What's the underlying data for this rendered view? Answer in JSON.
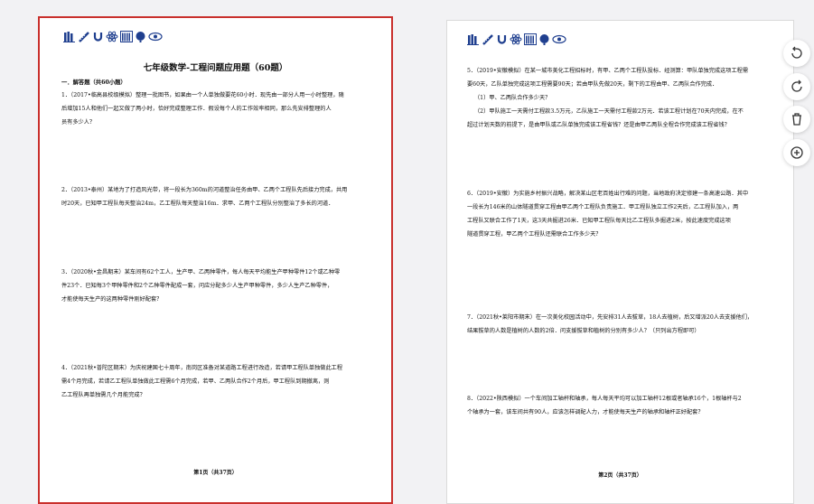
{
  "page1": {
    "doc_title": "七年级数学-工程问题应用题（60题）",
    "section": "一．解答题（共60小题）",
    "questions": [
      {
        "lines": [
          "1．（2017•临高县校级模拟）整理一批图书，如果由一个人单独做要花60小时．现先由一部分人用一小时整理，随",
          "后增加15人和他们一起又做了两小时，恰好完成整理工作．假设每个人的工作效率相同，那么先安排整理的人",
          "员有多少人？"
        ]
      },
      {
        "lines": [
          "2．（2013•泰州）某地为了打造风光带，将一段长为360m的河道整治任务由甲、乙两个工程队先后接力完成，共用",
          "时20天，已知甲工程队每天整治24m，乙工程队每天整治16m．求甲、乙两个工程队分别整治了多长的河道．"
        ]
      },
      {
        "lines": [
          "3．（2020秋•金昌期末）某车间有62个工人，生产甲、乙两种零件，每人每天平均能生产甲种零件12个或乙种零",
          "件23个．已知每3个甲种零件和2个乙种零件配成一套，问应分配多少人生产甲种零件，多少人生产乙种零件，",
          "才能使每天生产的这两种零件刚好配套？"
        ]
      },
      {
        "lines": [
          "4．（2021秋•普陀区期末）为庆祝建国七十周年，南岗区准备对某道路工程进行改造，若请甲工程队单独做此工程",
          "需4个月完成，若请乙工程队单独做此工程需6个月完成，若甲、乙两队合作2个月后，甲工程队到期撤离，则",
          "乙工程队再单独需几个月能完成？"
        ]
      }
    ],
    "footer": "第1页（共37页）"
  },
  "page2": {
    "questions": [
      {
        "lines": [
          "5．（2019•安徽模拟）在某一城市美化工程招标时，有甲、乙两个工程队投标．经测算：甲队单独完成这项工程需",
          "要60天，乙队单独完成这项工程需要90天；若由甲队先做20天，剩下的工程由甲、乙两队合作完成．",
          "（1）甲、乙两队合作多少天？",
          "（2）甲队施工一天需付工程款3.5万元，乙队施工一天需付工程款2万元．若该工程计划在70天内完成，在不",
          "超过计划天数的前提下，是由甲队或乙队单独完成该工程省钱？还是由甲乙两队全程合作完成该工程省钱？"
        ]
      },
      {
        "lines": [
          "6．（2019•安徽）为实施乡村振兴战略，解决某山区老百姓出行难的问题，当地政府决定修建一条高速公路．其中",
          "一段长为146米的山体隧道贯穿工程由甲乙两个工程队负责施工．甲工程队独立工作2天后，乙工程队加入，两",
          "工程队又联合工作了1天，这3天共掘进26米．已知甲工程队每天比乙工程队多掘进2米，按此速度完成这项",
          "隧道贯穿工程，甲乙两个工程队还需联合工作多少天？"
        ]
      },
      {
        "lines": [
          "7．（2021秋•莱阳市期末）在一次美化校园活动中，先安排31人去拔草，18人去植树，后又增派20人去支援他们，",
          "结果拔草的人数是植树的人数的2倍．问支援拔草和植树的分别有多少人？（只列出方程即可）"
        ]
      },
      {
        "lines": [
          "8．（2022•陕西模拟）一个车间加工轴杆和轴承，每人每天平均可以加工轴杆12根或者轴承16个，1根轴杆与2",
          "个轴承为一套，该车间共有90人，应该怎样调配人力，才能使每天生产的轴承和轴杆正好配套？"
        ]
      }
    ],
    "footer": "第2页（共37页）"
  },
  "header_icons": [
    "books-icon",
    "ruler-icon",
    "magnet-icon",
    "atom-icon",
    "bookshelf-icon",
    "globe-icon",
    "eye-icon"
  ],
  "side_tools": [
    "rotate-left-icon",
    "rotate-right-icon",
    "trash-icon",
    "zoom-in-icon"
  ],
  "colors": {
    "selected_border": "#c9302c",
    "icon_blue": "#1f3f8f",
    "background": "#f2f2f4"
  }
}
